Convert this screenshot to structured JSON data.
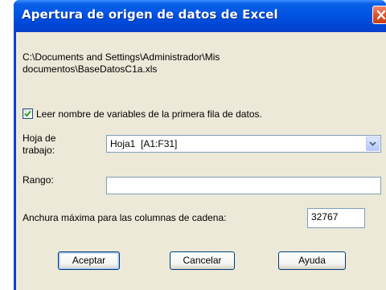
{
  "dialog": {
    "title": "Apertura de origen de datos de Excel",
    "file_path": "C:\\Documents and Settings\\Administrador\\Mis\ndocumentos\\BaseDatosC1a.xls",
    "read_names_label": "Leer nombre de variables de la primera fila de datos.",
    "read_names_checked": true,
    "worksheet_label": "Hoja de\ntrabajo:",
    "worksheet_value": "Hoja1  [A1:F31]",
    "range_label": "Rango:",
    "range_value": "",
    "max_width_label": "Anchura máxima para las columnas de cadena:",
    "max_width_value": "32767",
    "buttons": {
      "ok": "Aceptar",
      "cancel": "Cancelar",
      "help": "Ayuda"
    }
  },
  "colors": {
    "titlebar": "#0054e3",
    "client": "#ece9d8",
    "close_button": "#e0542c"
  },
  "icons": {
    "close": "close-icon",
    "dropdown": "chevron-down-icon",
    "check": "checkmark-icon"
  }
}
